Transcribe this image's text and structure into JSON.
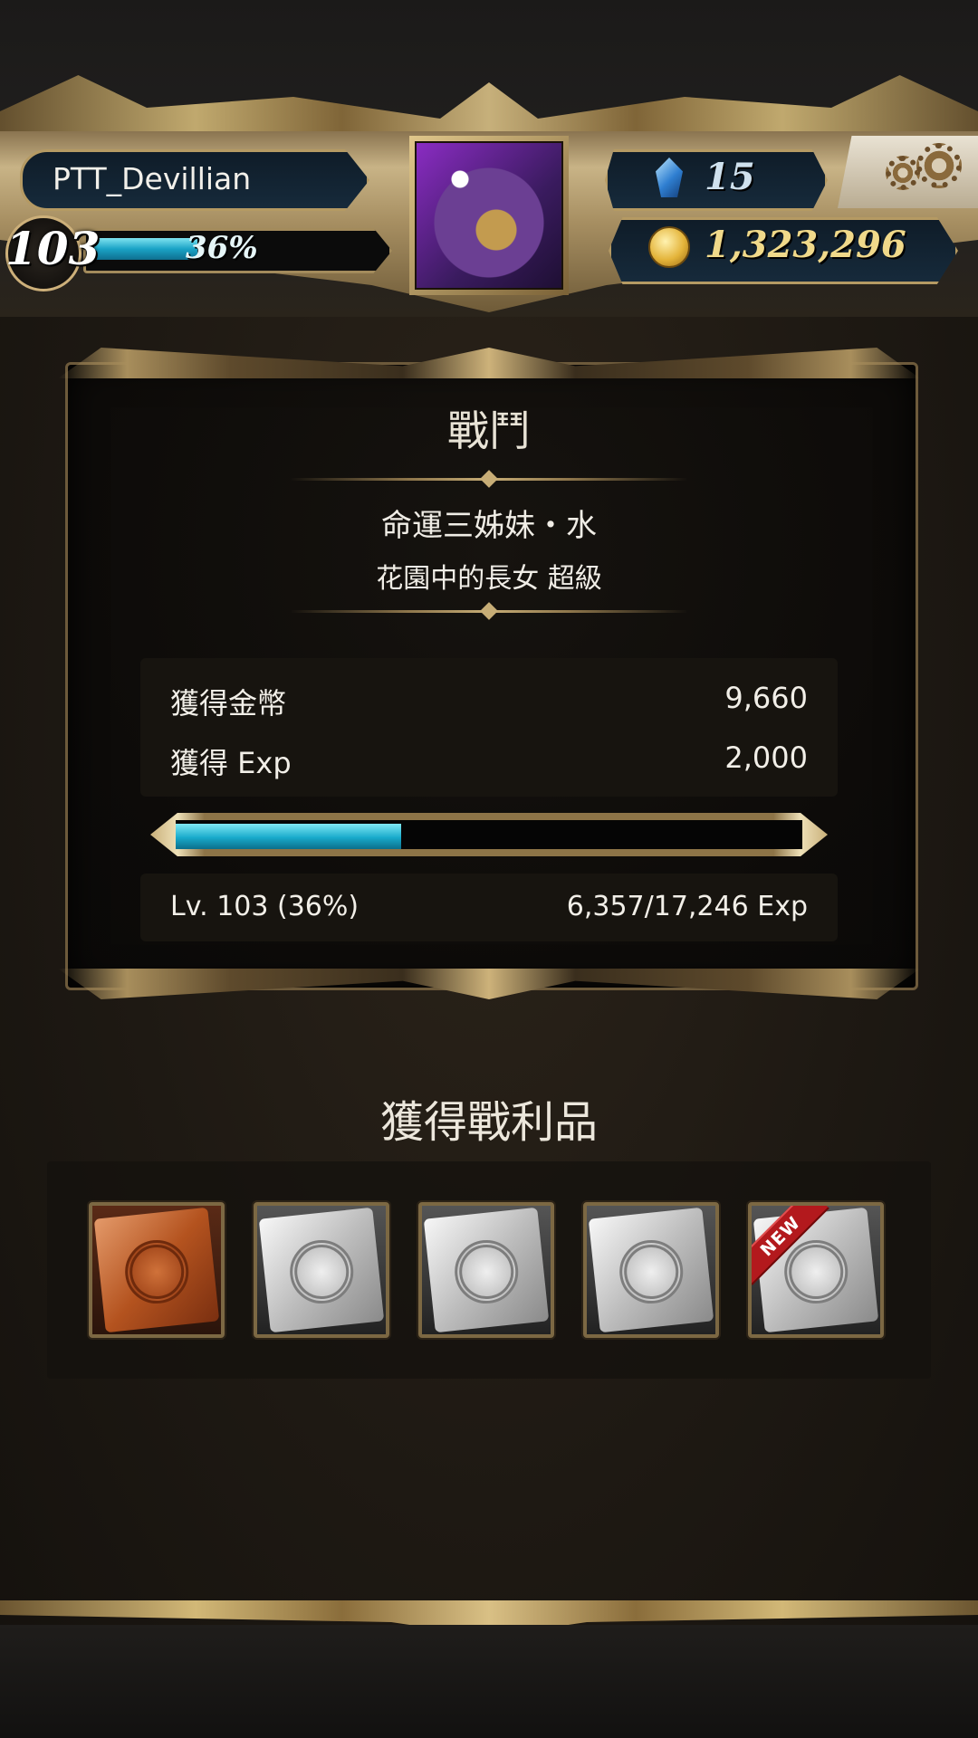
{
  "header": {
    "player_name": "PTT_Devillian",
    "level": "103",
    "exp_percent": "36%",
    "exp_fraction": 0.36,
    "gems": "15",
    "coins": "1,323,296"
  },
  "battle": {
    "title": "戰鬥",
    "enemy_name": "命運三姊妹・水",
    "stage_name": "花園中的長女 超級",
    "coins_label": "獲得金幣",
    "coins_value": "9,660",
    "exp_label": "獲得 Exp",
    "exp_value": "2,000",
    "level_text": "Lv. 103 (36%)",
    "exp_text": "6,357/17,246 Exp",
    "exp_fraction": 0.36
  },
  "loot": {
    "title": "獲得戰利品",
    "items": [
      {
        "type": "bronze-card",
        "new": false
      },
      {
        "type": "silver-card",
        "new": false
      },
      {
        "type": "silver-card",
        "new": false
      },
      {
        "type": "silver-card",
        "new": false
      },
      {
        "type": "silver-card",
        "new": true
      }
    ],
    "new_badge_text": "NEW"
  },
  "colors": {
    "exp_bar": "#1aa3c6",
    "gold_trim": "#b59a63",
    "coin_text": "#f0d98a"
  }
}
